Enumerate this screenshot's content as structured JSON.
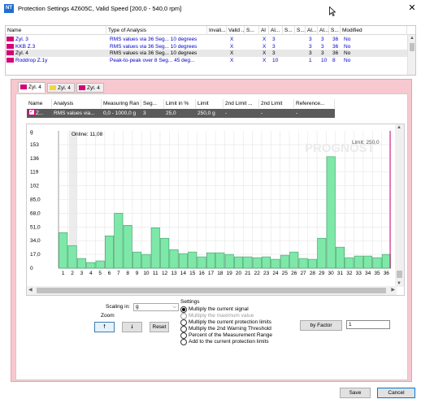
{
  "window": {
    "title": "Protection Settings 4Z605C, Valid Speed [200,0 - 540,0 rpm]",
    "icon_label": "NT",
    "close_symbol": "✕"
  },
  "top_table": {
    "columns": [
      "Name",
      "Type of Analysis",
      "Invali...",
      "Valid ...",
      "S...",
      "Al",
      "Al...",
      "S...",
      "S...",
      "Al...",
      "Al...",
      "S...",
      "Modified"
    ],
    "rows": [
      {
        "name": "Zyl. 3",
        "type": "RMS values via 36 Seg... 10 degrees",
        "c1": "",
        "c2": "X",
        "c3": "",
        "c4": "X",
        "c5": "3",
        "c6": "",
        "c7": "",
        "c8": "3",
        "c9": "3",
        "c10": "36",
        "modified": "No",
        "selected": false
      },
      {
        "name": "KKB Z.3",
        "type": "RMS values via 36 Seg... 10 degrees",
        "c1": "",
        "c2": "X",
        "c3": "",
        "c4": "X",
        "c5": "3",
        "c6": "",
        "c7": "",
        "c8": "3",
        "c9": "3",
        "c10": "36",
        "modified": "No",
        "selected": false
      },
      {
        "name": "Zyl. 4",
        "type": "RMS values via 36 Seg... 10 degrees",
        "c1": "",
        "c2": "X",
        "c3": "",
        "c4": "X",
        "c5": "3",
        "c6": "",
        "c7": "",
        "c8": "3",
        "c9": "3",
        "c10": "36",
        "modified": "No",
        "selected": true
      },
      {
        "name": "Roddrop Z.1y",
        "type": "Peak-to-peak over 8 Seg... 45 deg...",
        "c1": "",
        "c2": "X",
        "c3": "",
        "c4": "X",
        "c5": "10",
        "c6": "",
        "c7": "",
        "c8": "1",
        "c9": "10",
        "c10": "8",
        "modified": "No",
        "selected": false
      }
    ]
  },
  "tabs": [
    {
      "label": "Zyl. 4",
      "active": true,
      "color": "#d60077"
    },
    {
      "label": "Zyl. 4",
      "active": false,
      "color": "#f2d640"
    },
    {
      "label": "Zyl. 4",
      "active": false,
      "color": "#d60077"
    }
  ],
  "sub_table": {
    "columns": [
      "Name",
      "Analysis",
      "Measuring Ran",
      "Seg...",
      "Limit in %",
      "Limit",
      "2nd Limit ...",
      "2nd Limit",
      "Reference..."
    ],
    "row": [
      "Z...",
      "RMS values via...",
      "0,0 - 1000,0 g",
      "3",
      "25,0",
      "250,0 g",
      "-",
      "-",
      "-"
    ]
  },
  "chart": {
    "online_label": "Online: 11,08",
    "limit_label": "Limit: 250,0",
    "watermark": "PROGNOST",
    "unit_label": "g"
  },
  "chart_data": {
    "type": "bar",
    "title": "",
    "xlabel": "",
    "ylabel": "g",
    "ylim": [
      0,
      170
    ],
    "yticks": [
      "0",
      "17,0",
      "34,0",
      "51,0",
      "68,0",
      "85,0",
      "102",
      "119",
      "136",
      "153"
    ],
    "categories": [
      "1",
      "2",
      "3",
      "4",
      "5",
      "6",
      "7",
      "8",
      "9",
      "10",
      "11",
      "12",
      "13",
      "14",
      "15",
      "16",
      "17",
      "18",
      "19",
      "20",
      "21",
      "22",
      "23",
      "24",
      "25",
      "26",
      "27",
      "28",
      "29",
      "30",
      "31",
      "32",
      "33",
      "34",
      "35",
      "36"
    ],
    "values": [
      44,
      28,
      12,
      7,
      9,
      40,
      68,
      53,
      20,
      17,
      50,
      37,
      23,
      18,
      20,
      14,
      19,
      19,
      17,
      14,
      14,
      13,
      14,
      11,
      16,
      20,
      12,
      11,
      37,
      138,
      26,
      13,
      15,
      15,
      13,
      17
    ],
    "bar_color": "#7ee8a8",
    "limit_color": "#d60077",
    "grid": true
  },
  "controls": {
    "scaling_label": "Scaling in:",
    "scaling_value": "g",
    "zoom_label": "Zoom",
    "zoom_in_symbol": "🠕",
    "zoom_out_symbol": "🠗",
    "reset_label": "Reset",
    "settings_label": "Settings",
    "options": [
      {
        "label": "Multiply the current signal",
        "checked": true,
        "disabled": false
      },
      {
        "label": "Multiply the maximum value",
        "checked": false,
        "disabled": true
      },
      {
        "label": "Multiply the current protection limits",
        "checked": false,
        "disabled": false
      },
      {
        "label": "Multiply the 2nd Warning Threshold",
        "checked": false,
        "disabled": false
      },
      {
        "label": "Percent of the Measurement Range",
        "checked": false,
        "disabled": false
      },
      {
        "label": "Add to the current protection limits",
        "checked": false,
        "disabled": false
      }
    ],
    "by_factor_label": "by Factor",
    "factor_value": "1"
  },
  "footer": {
    "save_label": "Save",
    "cancel_label": "Cancel"
  }
}
